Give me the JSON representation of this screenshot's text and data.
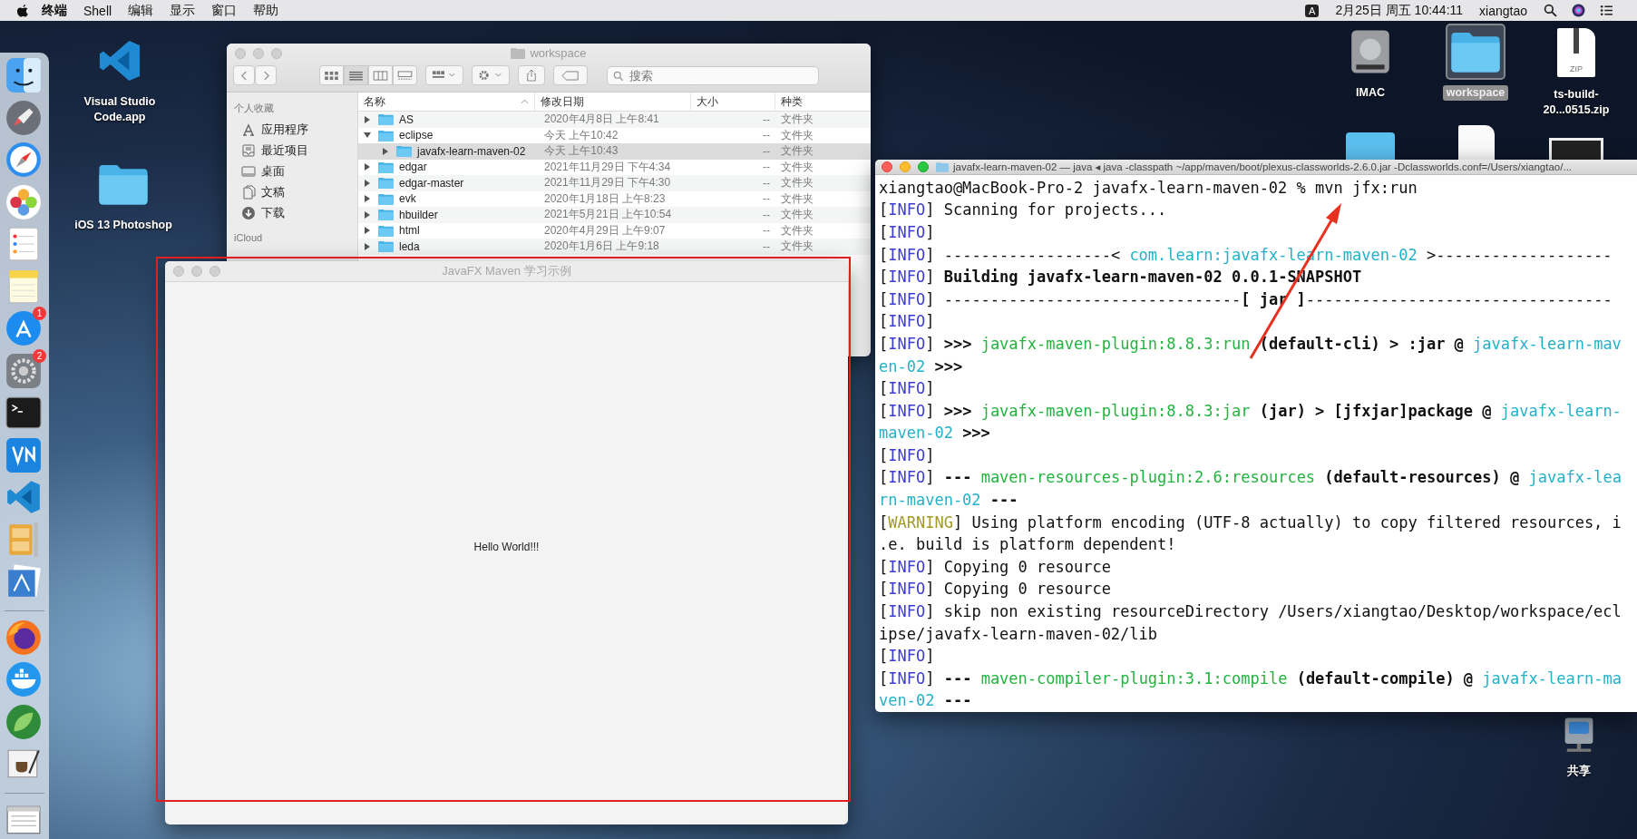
{
  "menu_bar": {
    "app_name": "终端",
    "menus": [
      "Shell",
      "编辑",
      "显示",
      "窗口",
      "帮助"
    ],
    "input_source": "A",
    "clock": "2月25日 周五 10:44:11",
    "user": "xiangtao"
  },
  "dock": {
    "items": [
      {
        "kind": "finder"
      },
      {
        "kind": "launchpad"
      },
      {
        "kind": "safari"
      },
      {
        "kind": "photos"
      },
      {
        "kind": "reminders"
      },
      {
        "kind": "notes"
      },
      {
        "kind": "appstore",
        "badge": "1"
      },
      {
        "kind": "preferences",
        "badge": "2"
      },
      {
        "kind": "terminal"
      },
      {
        "kind": "vnc"
      },
      {
        "kind": "vscode"
      },
      {
        "kind": "archiver"
      },
      {
        "kind": "preview"
      },
      {
        "kind": "separator"
      },
      {
        "kind": "firefox"
      },
      {
        "kind": "docker"
      },
      {
        "kind": "spring"
      },
      {
        "kind": "script"
      },
      {
        "kind": "separator"
      },
      {
        "kind": "screenshot"
      }
    ]
  },
  "desktop_icons": [
    {
      "label": "Visual Studio Code.app",
      "kind": "vscode",
      "selected": false
    },
    {
      "label": "iOS 13 Photoshop",
      "kind": "folder",
      "selected": false
    },
    {
      "label": "IMAC",
      "kind": "disk",
      "selected": false
    },
    {
      "label": "workspace",
      "kind": "folder",
      "selected": true
    },
    {
      "label": "ts-build-20...0515.zip",
      "kind": "zip",
      "file_type": "ZIP",
      "selected": false
    },
    {
      "label": "共享",
      "kind": "share",
      "selected": false
    }
  ],
  "finder": {
    "title": "workspace",
    "search_placeholder": "搜索",
    "view_modes": [
      {
        "kind": "icons",
        "selected": false
      },
      {
        "kind": "list",
        "selected": true
      },
      {
        "kind": "columns",
        "selected": false
      },
      {
        "kind": "gallery",
        "selected": false
      }
    ],
    "sidebar": [
      {
        "heading": "个人收藏",
        "items": [
          {
            "label": "应用程序",
            "kind": "apps"
          },
          {
            "label": "最近项目",
            "kind": "recent"
          },
          {
            "label": "桌面",
            "kind": "desktop"
          },
          {
            "label": "文稿",
            "kind": "documents"
          },
          {
            "label": "下载",
            "kind": "downloads"
          }
        ]
      },
      {
        "heading": "iCloud"
      }
    ],
    "columns": [
      {
        "label": "名称",
        "sorted": true
      },
      {
        "label": "修改日期",
        "sorted": false
      },
      {
        "label": "大小",
        "sorted": false
      },
      {
        "label": "种类",
        "sorted": false
      }
    ],
    "rows": [
      {
        "name": "AS",
        "date": "2020年4月8日 上午8:41",
        "size": "--",
        "type": "文件夹",
        "expanded": false,
        "selected": false
      },
      {
        "name": "eclipse",
        "date": "今天 上午10:42",
        "size": "--",
        "type": "文件夹",
        "expanded": true,
        "selected": false,
        "children": [
          {
            "name": "javafx-learn-maven-02",
            "date": "今天 上午10:43",
            "size": "--",
            "type": "文件夹",
            "expanded": false,
            "selected": true
          }
        ]
      },
      {
        "name": "edgar",
        "date": "2021年11月29日 下午4:34",
        "size": "--",
        "type": "文件夹",
        "expanded": false,
        "selected": false
      },
      {
        "name": "edgar-master",
        "date": "2021年11月29日 下午4:30",
        "size": "--",
        "type": "文件夹",
        "expanded": false,
        "selected": false
      },
      {
        "name": "evk",
        "date": "2020年1月18日 上午8:23",
        "size": "--",
        "type": "文件夹",
        "expanded": false,
        "selected": false
      },
      {
        "name": "hbuilder",
        "date": "2021年5月21日 上午10:54",
        "size": "--",
        "type": "文件夹",
        "expanded": false,
        "selected": false
      },
      {
        "name": "html",
        "date": "2020年4月29日 上午9:07",
        "size": "--",
        "type": "文件夹",
        "expanded": false,
        "selected": false
      },
      {
        "name": "leda",
        "date": "2020年1月6日 上午9:18",
        "size": "--",
        "type": "文件夹",
        "expanded": false,
        "selected": false
      }
    ]
  },
  "javafx_window": {
    "title": "JavaFX Maven 学习示例",
    "message": "Hello World!!!"
  },
  "terminal": {
    "title": "javafx-learn-maven-02 — java ◂ java -classpath ~/app/maven/boot/plexus-classworlds-2.6.0.jar -Dclassworlds.conf=/Users/xiangtao/...",
    "lines": [
      [
        {
          "text": "xiangtao@MacBook-Pro-2 javafx-learn-maven-02 % mvn jfx:run",
          "kind": "plain"
        }
      ],
      [
        {
          "text": "[",
          "kind": "plain"
        },
        {
          "text": "INFO",
          "kind": "info"
        },
        {
          "text": "] Scanning for projects...",
          "kind": "plain"
        }
      ],
      [
        {
          "text": "[",
          "kind": "plain"
        },
        {
          "text": "INFO",
          "kind": "info"
        },
        {
          "text": "]",
          "kind": "plain"
        }
      ],
      [
        {
          "text": "[",
          "kind": "plain"
        },
        {
          "text": "INFO",
          "kind": "info"
        },
        {
          "text": "] ------------------< ",
          "kind": "plain"
        },
        {
          "text": "com.learn:javafx-learn-maven-02",
          "kind": "project"
        },
        {
          "text": " >-------------------",
          "kind": "plain"
        }
      ],
      [
        {
          "text": "[",
          "kind": "plain"
        },
        {
          "text": "INFO",
          "kind": "info"
        },
        {
          "text": "] ",
          "kind": "plain"
        },
        {
          "text": "Building javafx-learn-maven-02 0.0.1-SNAPSHOT",
          "kind": "bold"
        }
      ],
      [
        {
          "text": "[",
          "kind": "plain"
        },
        {
          "text": "INFO",
          "kind": "info"
        },
        {
          "text": "] --------------------------------",
          "kind": "plain"
        },
        {
          "text": "[ jar ]",
          "kind": "bold"
        },
        {
          "text": "---------------------------------",
          "kind": "plain"
        }
      ],
      [
        {
          "text": "[",
          "kind": "plain"
        },
        {
          "text": "INFO",
          "kind": "info"
        },
        {
          "text": "]",
          "kind": "plain"
        }
      ],
      [
        {
          "text": "[",
          "kind": "plain"
        },
        {
          "text": "INFO",
          "kind": "info"
        },
        {
          "text": "] ",
          "kind": "plain"
        },
        {
          "text": ">>> ",
          "kind": "bold"
        },
        {
          "text": "javafx-maven-plugin:8.8.3:run",
          "kind": "plugin"
        },
        {
          "text": " (default-cli) > :jar @ ",
          "kind": "bold"
        },
        {
          "text": "javafx-learn-mav",
          "kind": "project"
        }
      ],
      [
        {
          "text": "en-02",
          "kind": "project"
        },
        {
          "text": " >>>",
          "kind": "bold"
        }
      ],
      [
        {
          "text": "[",
          "kind": "plain"
        },
        {
          "text": "INFO",
          "kind": "info"
        },
        {
          "text": "]",
          "kind": "plain"
        }
      ],
      [
        {
          "text": "[",
          "kind": "plain"
        },
        {
          "text": "INFO",
          "kind": "info"
        },
        {
          "text": "] ",
          "kind": "plain"
        },
        {
          "text": ">>> ",
          "kind": "bold"
        },
        {
          "text": "javafx-maven-plugin:8.8.3:jar",
          "kind": "plugin"
        },
        {
          "text": " (jar) > [jfxjar]package @ ",
          "kind": "bold"
        },
        {
          "text": "javafx-learn-",
          "kind": "project"
        }
      ],
      [
        {
          "text": "maven-02",
          "kind": "project"
        },
        {
          "text": " >>>",
          "kind": "bold"
        }
      ],
      [
        {
          "text": "[",
          "kind": "plain"
        },
        {
          "text": "INFO",
          "kind": "info"
        },
        {
          "text": "]",
          "kind": "plain"
        }
      ],
      [
        {
          "text": "[",
          "kind": "plain"
        },
        {
          "text": "INFO",
          "kind": "info"
        },
        {
          "text": "] ",
          "kind": "plain"
        },
        {
          "text": "--- ",
          "kind": "bold"
        },
        {
          "text": "maven-resources-plugin:2.6:resources",
          "kind": "plugin"
        },
        {
          "text": " (default-resources) @ ",
          "kind": "bold"
        },
        {
          "text": "javafx-lea",
          "kind": "project"
        }
      ],
      [
        {
          "text": "rn-maven-02",
          "kind": "project"
        },
        {
          "text": " ---",
          "kind": "bold"
        }
      ],
      [
        {
          "text": "[",
          "kind": "plain"
        },
        {
          "text": "WARNING",
          "kind": "warning"
        },
        {
          "text": "] Using platform encoding (UTF-8 actually) to copy filtered resources, i",
          "kind": "plain"
        }
      ],
      [
        {
          "text": ".e. build is platform dependent!",
          "kind": "plain"
        }
      ],
      [
        {
          "text": "[",
          "kind": "plain"
        },
        {
          "text": "INFO",
          "kind": "info"
        },
        {
          "text": "] Copying 0 resource",
          "kind": "plain"
        }
      ],
      [
        {
          "text": "[",
          "kind": "plain"
        },
        {
          "text": "INFO",
          "kind": "info"
        },
        {
          "text": "] Copying 0 resource",
          "kind": "plain"
        }
      ],
      [
        {
          "text": "[",
          "kind": "plain"
        },
        {
          "text": "INFO",
          "kind": "info"
        },
        {
          "text": "] skip non existing resourceDirectory /Users/xiangtao/Desktop/workspace/ecl",
          "kind": "plain"
        }
      ],
      [
        {
          "text": "ipse/javafx-learn-maven-02/lib",
          "kind": "plain"
        }
      ],
      [
        {
          "text": "[",
          "kind": "plain"
        },
        {
          "text": "INFO",
          "kind": "info"
        },
        {
          "text": "]",
          "kind": "plain"
        }
      ],
      [
        {
          "text": "[",
          "kind": "plain"
        },
        {
          "text": "INFO",
          "kind": "info"
        },
        {
          "text": "] ",
          "kind": "plain"
        },
        {
          "text": "--- ",
          "kind": "bold"
        },
        {
          "text": "maven-compiler-plugin:3.1:compile",
          "kind": "plugin"
        },
        {
          "text": " (default-compile) @ ",
          "kind": "bold"
        },
        {
          "text": "javafx-learn-ma",
          "kind": "project"
        }
      ],
      [
        {
          "text": "ven-02",
          "kind": "project"
        },
        {
          "text": " ---",
          "kind": "bold"
        }
      ]
    ]
  }
}
